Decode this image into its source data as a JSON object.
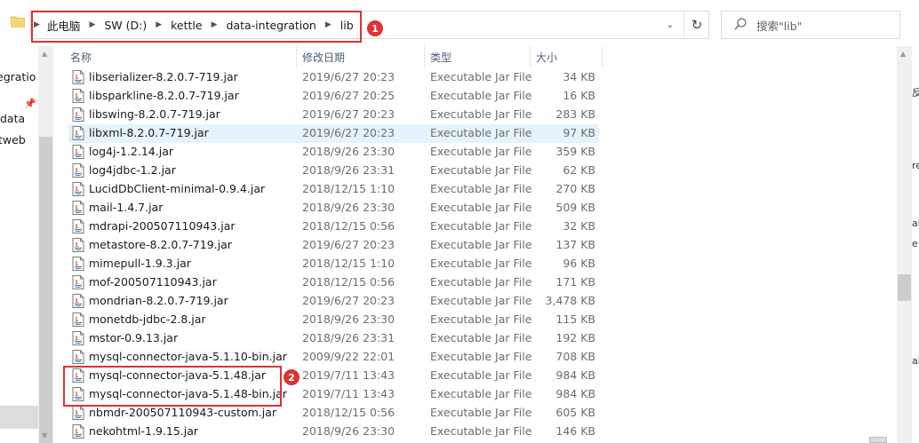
{
  "breadcrumb": [
    "此电脑",
    "SW (D:)",
    "kettle",
    "data-integration",
    "lib"
  ],
  "search": {
    "placeholder": "搜索\"lib\""
  },
  "annotations": [
    "1",
    "2"
  ],
  "columns": {
    "name": "名称",
    "date": "修改日期",
    "type": "类型",
    "size": "大小"
  },
  "nav_items": [
    "egratio",
    "data",
    "tweb"
  ],
  "right_pane_fragments": [
    "反",
    "re",
    "ab",
    "e",
    "ab"
  ],
  "files": [
    {
      "name": "libserializer-8.2.0.7-719.jar",
      "date": "2019/6/27 20:23",
      "type": "Executable Jar File",
      "size": "34 KB"
    },
    {
      "name": "libsparkline-8.2.0.7-719.jar",
      "date": "2019/6/27 20:25",
      "type": "Executable Jar File",
      "size": "16 KB"
    },
    {
      "name": "libswing-8.2.0.7-719.jar",
      "date": "2019/6/27 20:23",
      "type": "Executable Jar File",
      "size": "283 KB"
    },
    {
      "name": "libxml-8.2.0.7-719.jar",
      "date": "2019/6/27 20:23",
      "type": "Executable Jar File",
      "size": "97 KB",
      "selected": true
    },
    {
      "name": "log4j-1.2.14.jar",
      "date": "2018/9/26 23:30",
      "type": "Executable Jar File",
      "size": "359 KB"
    },
    {
      "name": "log4jdbc-1.2.jar",
      "date": "2018/9/26 23:31",
      "type": "Executable Jar File",
      "size": "62 KB"
    },
    {
      "name": "LucidDbClient-minimal-0.9.4.jar",
      "date": "2018/12/15 1:10",
      "type": "Executable Jar File",
      "size": "270 KB"
    },
    {
      "name": "mail-1.4.7.jar",
      "date": "2018/9/26 23:30",
      "type": "Executable Jar File",
      "size": "509 KB"
    },
    {
      "name": "mdrapi-200507110943.jar",
      "date": "2018/12/15 0:56",
      "type": "Executable Jar File",
      "size": "32 KB"
    },
    {
      "name": "metastore-8.2.0.7-719.jar",
      "date": "2019/6/27 20:23",
      "type": "Executable Jar File",
      "size": "137 KB"
    },
    {
      "name": "mimepull-1.9.3.jar",
      "date": "2018/12/15 1:10",
      "type": "Executable Jar File",
      "size": "96 KB"
    },
    {
      "name": "mof-200507110943.jar",
      "date": "2018/12/15 0:56",
      "type": "Executable Jar File",
      "size": "171 KB"
    },
    {
      "name": "mondrian-8.2.0.7-719.jar",
      "date": "2019/6/27 20:23",
      "type": "Executable Jar File",
      "size": "3,478 KB"
    },
    {
      "name": "monetdb-jdbc-2.8.jar",
      "date": "2018/9/26 23:30",
      "type": "Executable Jar File",
      "size": "115 KB"
    },
    {
      "name": "mstor-0.9.13.jar",
      "date": "2018/9/26 23:31",
      "type": "Executable Jar File",
      "size": "192 KB"
    },
    {
      "name": "mysql-connector-java-5.1.10-bin.jar",
      "date": "2009/9/22 22:01",
      "type": "Executable Jar File",
      "size": "708 KB"
    },
    {
      "name": "mysql-connector-java-5.1.48.jar",
      "date": "2019/7/11 13:43",
      "type": "Executable Jar File",
      "size": "984 KB"
    },
    {
      "name": "mysql-connector-java-5.1.48-bin.jar",
      "date": "2019/7/11 13:43",
      "type": "Executable Jar File",
      "size": "984 KB"
    },
    {
      "name": "nbmdr-200507110943-custom.jar",
      "date": "2018/12/15 0:56",
      "type": "Executable Jar File",
      "size": "605 KB"
    },
    {
      "name": "nekohtml-1.9.15.jar",
      "date": "2018/9/26 23:30",
      "type": "Executable Jar File",
      "size": "146 KB"
    }
  ]
}
